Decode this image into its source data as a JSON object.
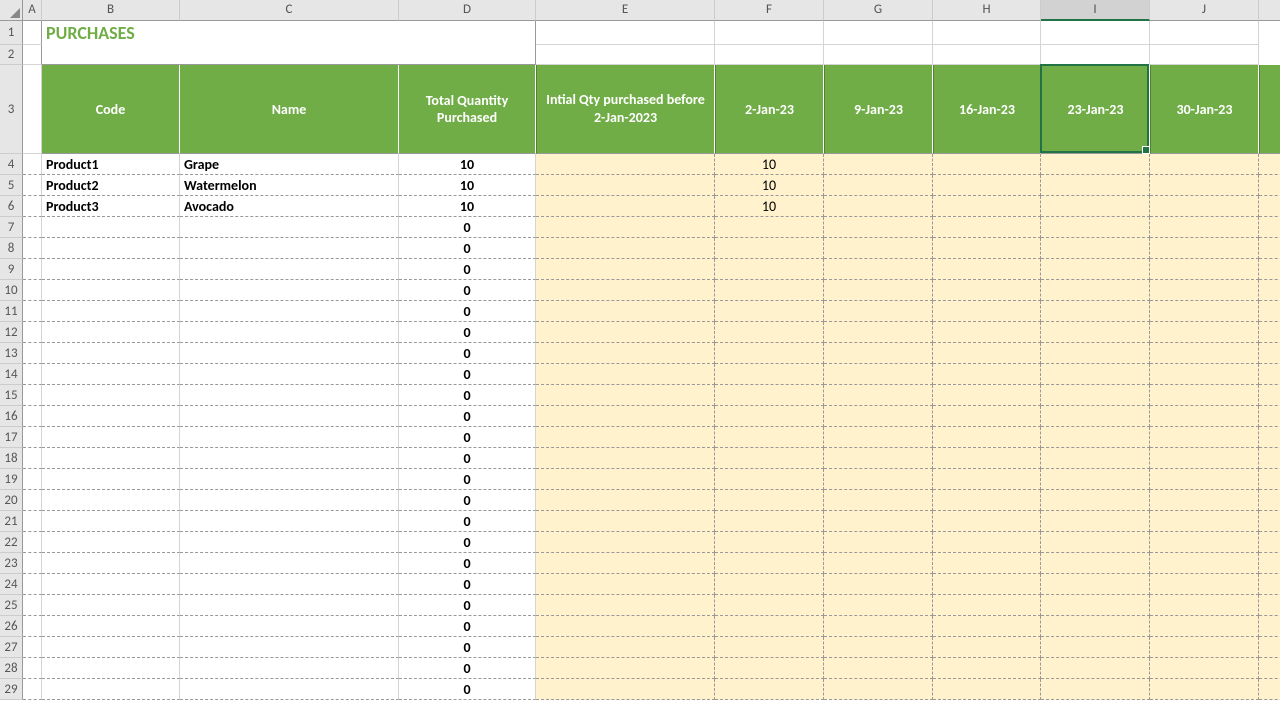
{
  "title": "PURCHASES",
  "columns": {
    "letters": [
      "A",
      "B",
      "C",
      "D",
      "E",
      "F",
      "G",
      "H",
      "I",
      "J"
    ],
    "widths": [
      19,
      138,
      219,
      137,
      179,
      109,
      109,
      108,
      109,
      109
    ]
  },
  "rows": {
    "numbers": [
      "1",
      "2",
      "3",
      "4",
      "5",
      "6",
      "7",
      "8",
      "9",
      "10",
      "11",
      "12",
      "13",
      "14",
      "15",
      "16",
      "17",
      "18",
      "19",
      "20",
      "21",
      "22",
      "23",
      "24",
      "25",
      "26",
      "27",
      "28",
      "29"
    ],
    "heights": [
      24,
      20,
      89,
      21,
      21,
      21,
      21,
      21,
      21,
      21,
      21,
      21,
      21,
      21,
      21,
      21,
      21,
      21,
      21,
      21,
      21,
      21,
      21,
      21,
      21,
      21,
      21,
      21,
      21
    ]
  },
  "headers": {
    "code": "Code",
    "name": "Name",
    "total": "Total Quantity Purchased",
    "initial": "Intial Qty purchased before 2-Jan-2023",
    "d1": "2-Jan-23",
    "d2": "9-Jan-23",
    "d3": "16-Jan-23",
    "d4": "23-Jan-23",
    "d5": "30-Jan-23"
  },
  "products": [
    {
      "code": "Product1",
      "name": "Grape",
      "total": "10",
      "f": "10"
    },
    {
      "code": "Product2",
      "name": "Watermelon",
      "total": "10",
      "f": "10"
    },
    {
      "code": "Product3",
      "name": "Avocado",
      "total": "10",
      "f": "10"
    }
  ],
  "zero": "0",
  "selected_col_index": 8
}
